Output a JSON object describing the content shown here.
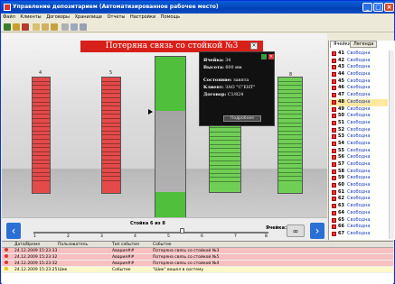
{
  "title": "Управление депозитарием (Автоматизированное рабочее место)",
  "menu": [
    "Файл",
    "Клиенты",
    "Договоры",
    "Хранилище",
    "Отчеты",
    "Настройки",
    "Помощь"
  ],
  "rack_labels": [
    "4",
    "5",
    "",
    "",
    "",
    "8"
  ],
  "tabs": [
    "Ячейки",
    "Легенда"
  ],
  "cells": [
    {
      "num": "41",
      "label": "Свободна"
    },
    {
      "num": "42",
      "label": "Свободна"
    },
    {
      "num": "43",
      "label": "Свободна"
    },
    {
      "num": "44",
      "label": "Свободна"
    },
    {
      "num": "45",
      "label": "Свободна"
    },
    {
      "num": "46",
      "label": "Свободна"
    },
    {
      "num": "47",
      "label": "Свободна"
    },
    {
      "num": "48",
      "label": "Свободна"
    },
    {
      "num": "49",
      "label": "Свободна"
    },
    {
      "num": "50",
      "label": "Свободна"
    },
    {
      "num": "51",
      "label": "Свободна"
    },
    {
      "num": "52",
      "label": "Свободна"
    },
    {
      "num": "53",
      "label": "Свободна"
    },
    {
      "num": "54",
      "label": "Свободна"
    },
    {
      "num": "55",
      "label": "Свободна"
    },
    {
      "num": "56",
      "label": "Свободна"
    },
    {
      "num": "57",
      "label": "Свободна"
    },
    {
      "num": "58",
      "label": "Свободна"
    },
    {
      "num": "59",
      "label": "Свободна"
    },
    {
      "num": "60",
      "label": "Свободна"
    },
    {
      "num": "61",
      "label": "Свободна"
    },
    {
      "num": "62",
      "label": "Свободна"
    },
    {
      "num": "63",
      "label": "Свободна"
    },
    {
      "num": "64",
      "label": "Свободна"
    },
    {
      "num": "65",
      "label": "Свободна"
    },
    {
      "num": "66",
      "label": "Свободна"
    },
    {
      "num": "67",
      "label": "Свободна"
    }
  ],
  "popup": {
    "title": "Потеряна связь со стойкой №3",
    "cell_label": "Ячейка:",
    "cell_value": "34",
    "height_label": "Высота:",
    "height_value": "600 мм",
    "state_label": "Состояние:",
    "state_value": "занята",
    "client_label": "Клиент:",
    "client_value": "ЗАО \"С\"ЕНТ\"",
    "contract_label": "Договор:",
    "contract_value": "С1/824",
    "button": "Подробнее"
  },
  "rack_caption": "Стойка 6 из 8",
  "cell_field_label": "Ячейка:",
  "slider_ticks": [
    "1",
    "2",
    "3",
    "4",
    "5",
    "6",
    "7",
    "8"
  ],
  "log": {
    "headers": [
      "Дата/Время",
      "Пользователь",
      "Тип события",
      "Событие"
    ],
    "rows": [
      {
        "time": "24.12.2009 15:23:33",
        "user": "",
        "type": "Авария##",
        "event": "Потеряна связь со стойкой №3",
        "color": "#d9362c",
        "bg": "#f7c0c0"
      },
      {
        "time": "24.12.2009 15:23:32",
        "user": "",
        "type": "Авария##",
        "event": "Потеряна связь со стойкой №5",
        "color": "#d9362c",
        "bg": "#f7c0c0"
      },
      {
        "time": "24.12.2009 15:23:32",
        "user": "",
        "type": "Авария##",
        "event": "Потеряна связь со стойкой №4",
        "color": "#d9362c",
        "bg": "#f7c0c0"
      },
      {
        "time": "24.12.2009 15:23:25",
        "user": "Шик",
        "type": "Событие",
        "event": "\"Шик\" вошел в систему",
        "color": "#f0c020",
        "bg": "#fdf7cc"
      }
    ]
  }
}
